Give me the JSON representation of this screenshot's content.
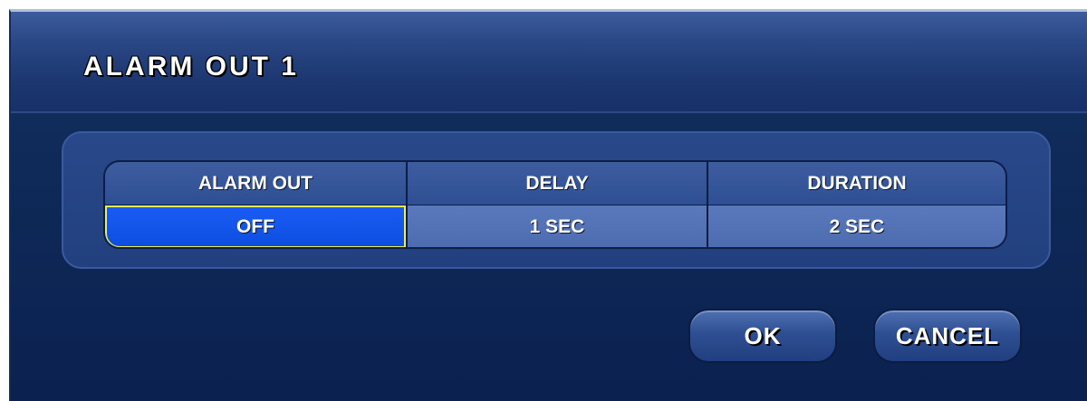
{
  "dialog": {
    "title": "ALARM OUT 1"
  },
  "table": {
    "headers": [
      "ALARM OUT",
      "DELAY",
      "DURATION"
    ],
    "values": [
      "OFF",
      "1 SEC",
      "2 SEC"
    ],
    "selected_index": 0
  },
  "buttons": {
    "ok_label": "OK",
    "cancel_label": "CANCEL"
  },
  "colors": {
    "selection_border": "#f0ec52",
    "selected_cell": "#1a5cf2",
    "background": "#0f2a58"
  }
}
